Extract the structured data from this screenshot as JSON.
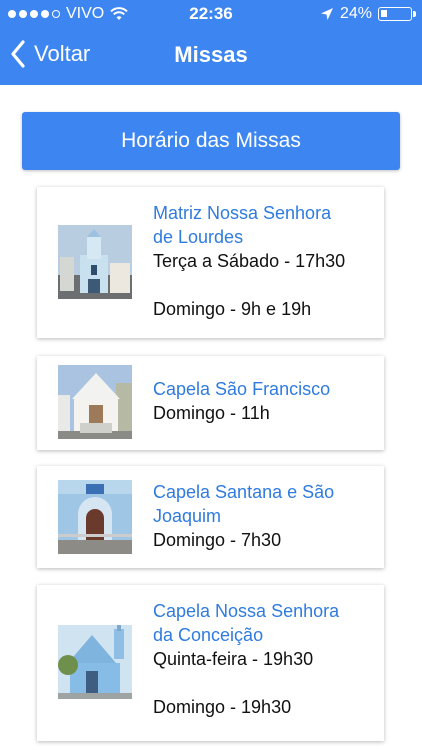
{
  "status_bar": {
    "carrier": "VIVO",
    "time": "22:36",
    "battery_text": "24%",
    "battery_level": 0.24,
    "signal_bars": 4
  },
  "nav": {
    "back_label": "Voltar",
    "title": "Missas"
  },
  "banner_label": "Horário das Missas",
  "colors": {
    "primary": "#3d86f2",
    "link": "#2f7bdf"
  },
  "churches": [
    {
      "name_lines": [
        "Matriz Nossa Senhora",
        "de Lourdes"
      ],
      "schedule": [
        "Terça a Sábado - 17h30",
        "",
        "Domingo - 9h e 19h"
      ]
    },
    {
      "name_lines": [
        "Capela São Francisco"
      ],
      "schedule": [
        "Domingo - 11h"
      ]
    },
    {
      "name_lines": [
        "Capela Santana e São",
        "Joaquim"
      ],
      "schedule": [
        "Domingo - 7h30"
      ]
    },
    {
      "name_lines": [
        "Capela Nossa Senhora",
        "da Conceição"
      ],
      "schedule": [
        "Quinta-feira - 19h30",
        "",
        "Domingo - 19h30"
      ]
    }
  ]
}
